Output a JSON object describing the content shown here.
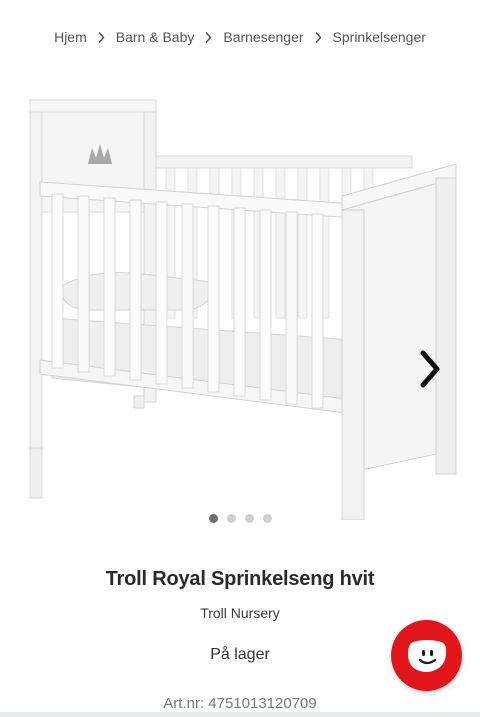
{
  "breadcrumb": {
    "items": [
      {
        "label": "Hjem"
      },
      {
        "label": "Barn & Baby"
      },
      {
        "label": "Barnesenger"
      },
      {
        "label": "Sprinkelsenger"
      }
    ]
  },
  "gallery": {
    "slide_count": 4,
    "active_slide": 1
  },
  "product": {
    "title": "Troll Royal Sprinkelseng hvit",
    "brand": "Troll Nursery",
    "stock_status": "På lager",
    "article_number": "Art.nr: 4751013120709"
  },
  "icons": {
    "next": "chevron-right-icon",
    "chat": "chat-face-icon",
    "separator": "chevron-right-small-icon"
  },
  "colors": {
    "chat_button": "#e0161b",
    "dot_active": "#6e6e6e",
    "dot_inactive": "#cfcfcf"
  }
}
